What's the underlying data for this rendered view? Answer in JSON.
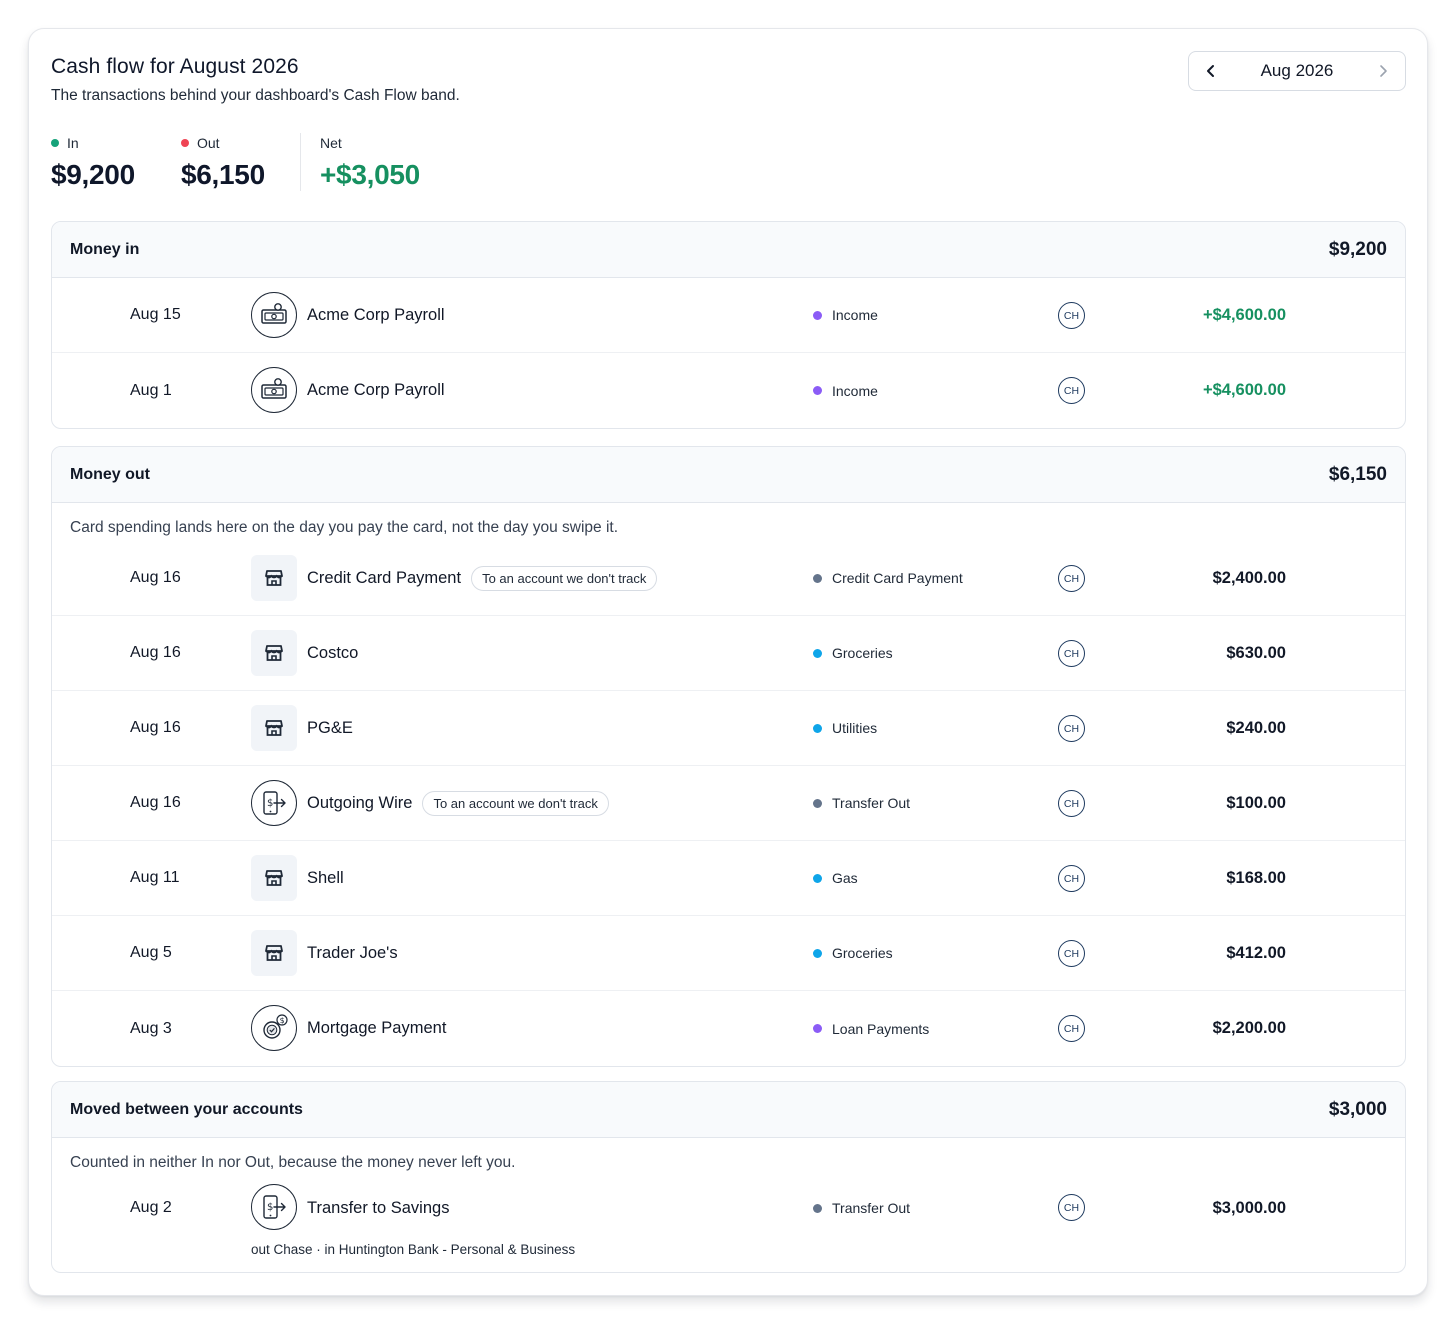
{
  "header": {
    "title": "Cash flow for August 2026",
    "subtitle": "The transactions behind your dashboard's Cash Flow band.",
    "month_label": "Aug 2026"
  },
  "stats": {
    "in": {
      "label": "In",
      "value": "$9,200",
      "color": "#16a37a"
    },
    "out": {
      "label": "Out",
      "value": "$6,150",
      "color": "#ef4454"
    },
    "net": {
      "label": "Net",
      "value": "+$3,050",
      "color": "#169060"
    }
  },
  "money_in": {
    "title": "Money in",
    "total": "$9,200",
    "rows": [
      {
        "date": "Aug 15",
        "icon": "payroll-icon",
        "merchant": "Acme Corp Payroll",
        "category": "Income",
        "cat_color": "#8b5cf6",
        "account": "CH",
        "amount": "+$4,600.00"
      },
      {
        "date": "Aug 1",
        "icon": "payroll-icon",
        "merchant": "Acme Corp Payroll",
        "category": "Income",
        "cat_color": "#8b5cf6",
        "account": "CH",
        "amount": "+$4,600.00"
      }
    ]
  },
  "money_out": {
    "title": "Money out",
    "total": "$6,150",
    "note": "Card spending lands here on the day you pay the card, not the day you swipe it.",
    "rows": [
      {
        "date": "Aug 16",
        "icon": "store-icon",
        "merchant": "Credit Card Payment",
        "pill": "To an account we don't track",
        "category": "Credit Card Payment",
        "cat_color": "#64748b",
        "account": "CH",
        "amount": "$2,400.00"
      },
      {
        "date": "Aug 16",
        "icon": "store-icon",
        "merchant": "Costco",
        "category": "Groceries",
        "cat_color": "#0ea5e9",
        "account": "CH",
        "amount": "$630.00"
      },
      {
        "date": "Aug 16",
        "icon": "store-icon",
        "merchant": "PG&E",
        "category": "Utilities",
        "cat_color": "#0ea5e9",
        "account": "CH",
        "amount": "$240.00"
      },
      {
        "date": "Aug 16",
        "icon": "transfer-icon",
        "merchant": "Outgoing Wire",
        "pill": "To an account we don't track",
        "category": "Transfer Out",
        "cat_color": "#64748b",
        "account": "CH",
        "amount": "$100.00"
      },
      {
        "date": "Aug 11",
        "icon": "store-icon",
        "merchant": "Shell",
        "category": "Gas",
        "cat_color": "#0ea5e9",
        "account": "CH",
        "amount": "$168.00"
      },
      {
        "date": "Aug 5",
        "icon": "store-icon",
        "merchant": "Trader Joe's",
        "category": "Groceries",
        "cat_color": "#0ea5e9",
        "account": "CH",
        "amount": "$412.00"
      },
      {
        "date": "Aug 3",
        "icon": "mortgage-icon",
        "merchant": "Mortgage Payment",
        "category": "Loan Payments",
        "cat_color": "#8b5cf6",
        "account": "CH",
        "amount": "$2,200.00"
      }
    ]
  },
  "moved": {
    "title": "Moved between your accounts",
    "total": "$3,000",
    "note": "Counted in neither In nor Out, because the money never left you.",
    "rows": [
      {
        "date": "Aug 2",
        "icon": "transfer-icon",
        "merchant": "Transfer to Savings",
        "sub": "out Chase · in Huntington Bank - Personal & Business",
        "category": "Transfer Out",
        "cat_color": "#64748b",
        "account": "CH",
        "amount": "$3,000.00"
      }
    ]
  }
}
